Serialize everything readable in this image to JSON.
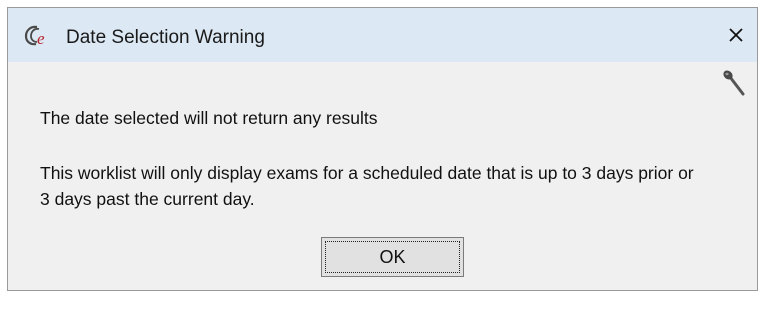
{
  "dialog": {
    "title": "Date Selection Warning",
    "icons": {
      "app": "epic-e-icon",
      "close": "close-icon",
      "microphone": "microphone-icon"
    },
    "message_primary": "The date selected will not return any results",
    "message_secondary": "This worklist will only display exams for a scheduled date that is up to 3 days prior or 3 days past the current day.",
    "ok_label": "OK"
  },
  "colors": {
    "titlebar_bg": "#dce8f3",
    "dialog_bg": "#f0f0f0",
    "icon_red": "#b8232a"
  }
}
